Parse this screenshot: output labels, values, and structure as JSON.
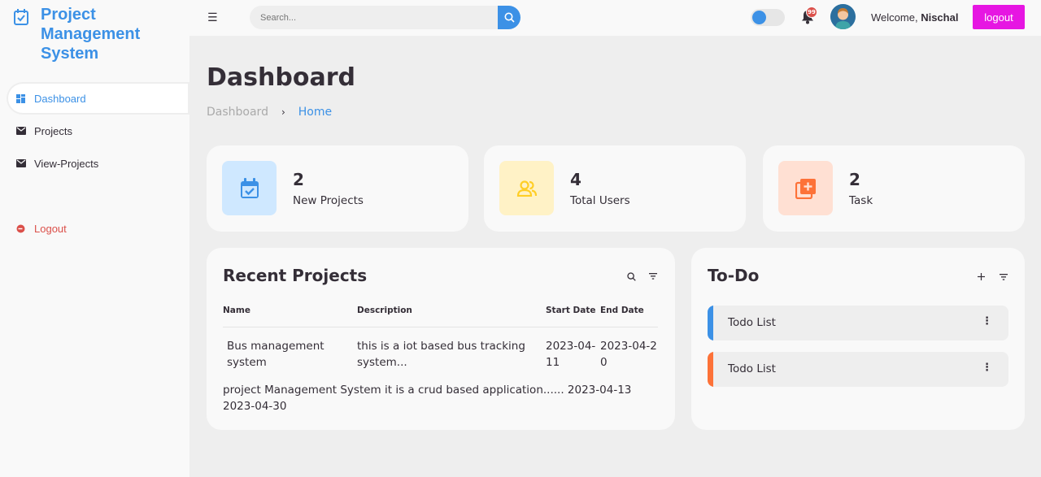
{
  "brand": {
    "title": "Project Management System"
  },
  "sidebar": {
    "items": [
      {
        "label": "Dashboard"
      },
      {
        "label": "Projects"
      },
      {
        "label": "View-Projects"
      },
      {
        "label": "Logout"
      }
    ]
  },
  "topbar": {
    "search_placeholder": "Search...",
    "notification_count": "99",
    "welcome_prefix": "Welcome,",
    "user_name": "Nischal",
    "logout_label": "logout"
  },
  "page": {
    "title": "Dashboard",
    "breadcrumb": [
      "Dashboard",
      "Home"
    ]
  },
  "stats": [
    {
      "value": "2",
      "label": "New Projects",
      "color": "#3c91e6",
      "bg": "#cfe8ff"
    },
    {
      "value": "4",
      "label": "Total Users",
      "color": "#ffce26",
      "bg": "#fff2c6"
    },
    {
      "value": "2",
      "label": "Task",
      "color": "#fd7238",
      "bg": "#ffe0d3"
    }
  ],
  "recent_projects": {
    "title": "Recent Projects",
    "columns": [
      "Name",
      "Description",
      "Start Date",
      "End Date"
    ],
    "rows": [
      {
        "name": "Bus management system",
        "description": "this is a iot based bus tracking system...",
        "start": "2023-04-11",
        "end": "2023-04-20"
      },
      {
        "text": "project Management System it is a crud based application...... 2023-04-13 2023-04-30"
      }
    ]
  },
  "todo": {
    "title": "To-Do",
    "items": [
      {
        "label": "Todo List",
        "color": "#3c91e6"
      },
      {
        "label": "Todo List",
        "color": "#fd7238"
      }
    ]
  },
  "colors": {
    "accent": "#3c91e6",
    "logout": "#e616e2",
    "danger": "#db504a"
  }
}
